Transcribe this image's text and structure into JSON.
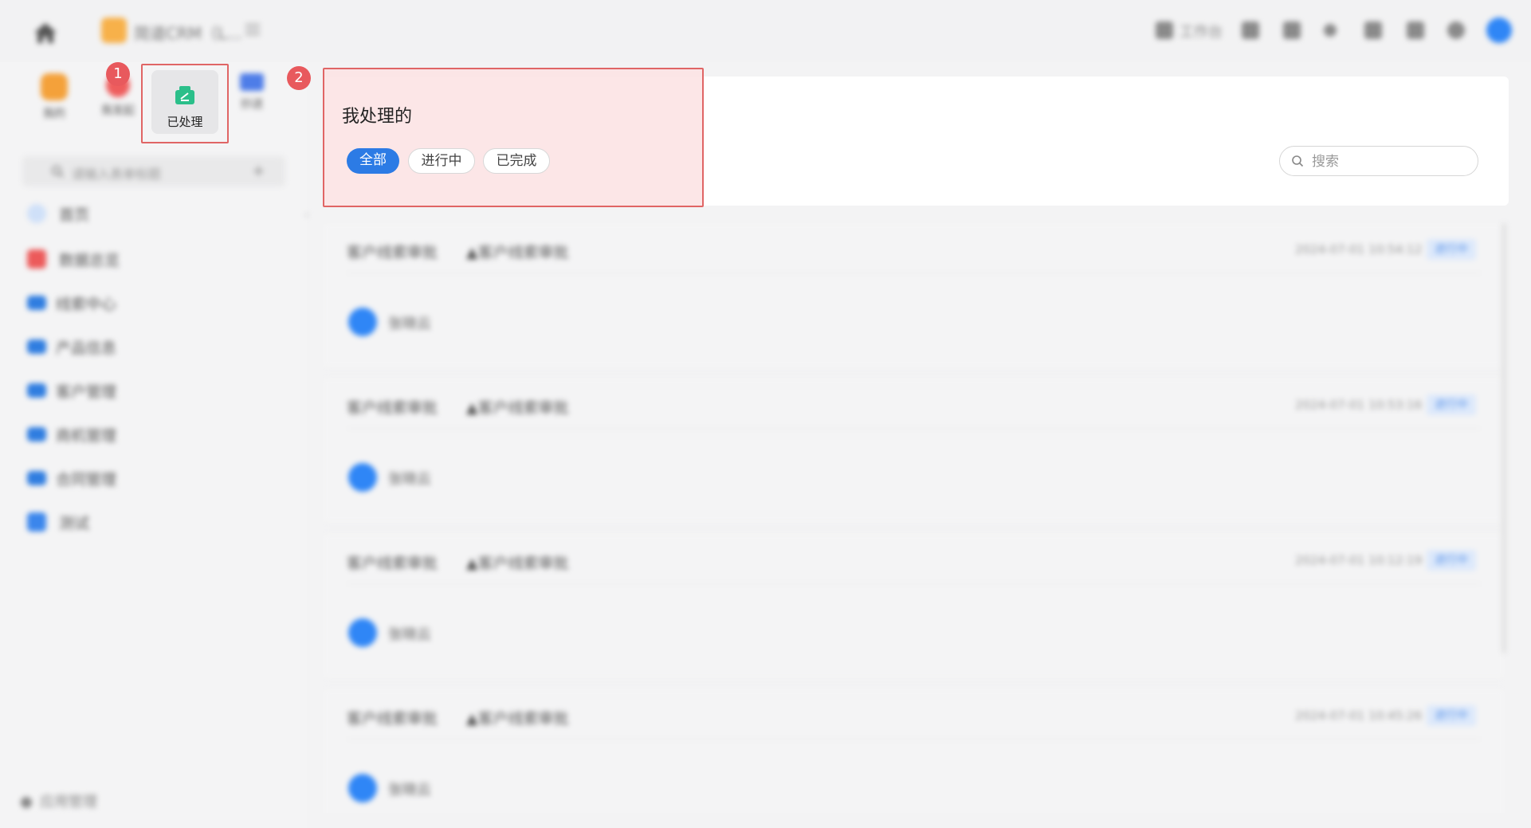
{
  "topbar": {
    "app_name": "简道CRM（L...",
    "workbench_label": "工作台",
    "icons": [
      "home-icon",
      "app-logo",
      "menu-icon",
      "grid-icon",
      "calendar-icon",
      "star-icon",
      "message-icon",
      "doc-icon",
      "settings-icon",
      "avatar"
    ]
  },
  "quick_actions": [
    {
      "label": "我的"
    },
    {
      "label": "我发起"
    },
    {
      "label": "已处理"
    },
    {
      "label": "抄送"
    }
  ],
  "sidebar": {
    "search_placeholder": "请输入表单标题",
    "items": [
      {
        "label": "首页"
      },
      {
        "label": "数据总览"
      },
      {
        "label": "线索中心"
      },
      {
        "label": "产品信息"
      },
      {
        "label": "客户管理"
      },
      {
        "label": "商机管理"
      },
      {
        "label": "合同管理"
      },
      {
        "label": "测试"
      }
    ],
    "footer": "应用管理"
  },
  "annotations": {
    "badge1": "1",
    "badge2": "2"
  },
  "main": {
    "title": "我处理的",
    "filters": [
      {
        "label": "全部",
        "active": true
      },
      {
        "label": "进行中",
        "active": false
      },
      {
        "label": "已完成",
        "active": false
      }
    ],
    "search_placeholder": "搜索"
  },
  "tasks": [
    {
      "title": "客户线索审批",
      "subtitle": "▲客户线索审批",
      "time": "2024-07-01 10:54:12",
      "status": "进行中",
      "user": "张晓云"
    },
    {
      "title": "客户线索审批",
      "subtitle": "▲客户线索审批",
      "time": "2024-07-01 10:53:16",
      "status": "进行中",
      "user": "张晓云"
    },
    {
      "title": "客户线索审批",
      "subtitle": "▲客户线索审批",
      "time": "2024-07-01 10:12:19",
      "status": "进行中",
      "user": "张晓云"
    },
    {
      "title": "客户线索审批",
      "subtitle": "▲客户线索审批",
      "time": "2024-07-01 10:45:26",
      "status": "进行中",
      "user": "张晓云"
    }
  ],
  "colors": {
    "accent": "#2c7be5",
    "highlight": "#e06565",
    "badge": "#e8595d"
  }
}
